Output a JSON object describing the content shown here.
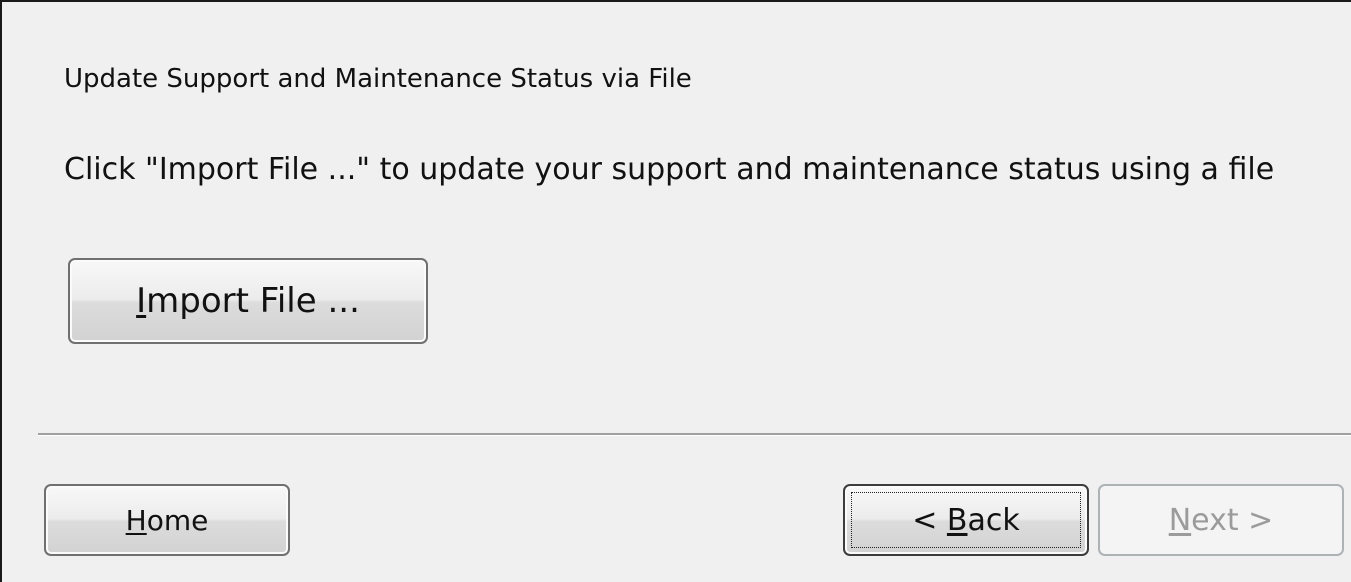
{
  "main": {
    "heading": "Update Support and Maintenance Status via File",
    "instruction": "Click \"Import File ...\" to update your support and maintenance status using a file",
    "import_button": {
      "accel": "I",
      "rest": "mport File ..."
    }
  },
  "footer": {
    "home_button": {
      "accel": "H",
      "rest": "ome"
    },
    "back_button": {
      "prefix": "< ",
      "accel": "B",
      "rest": "ack"
    },
    "next_button": {
      "accel": "N",
      "rest": "ext >",
      "enabled": false
    }
  }
}
